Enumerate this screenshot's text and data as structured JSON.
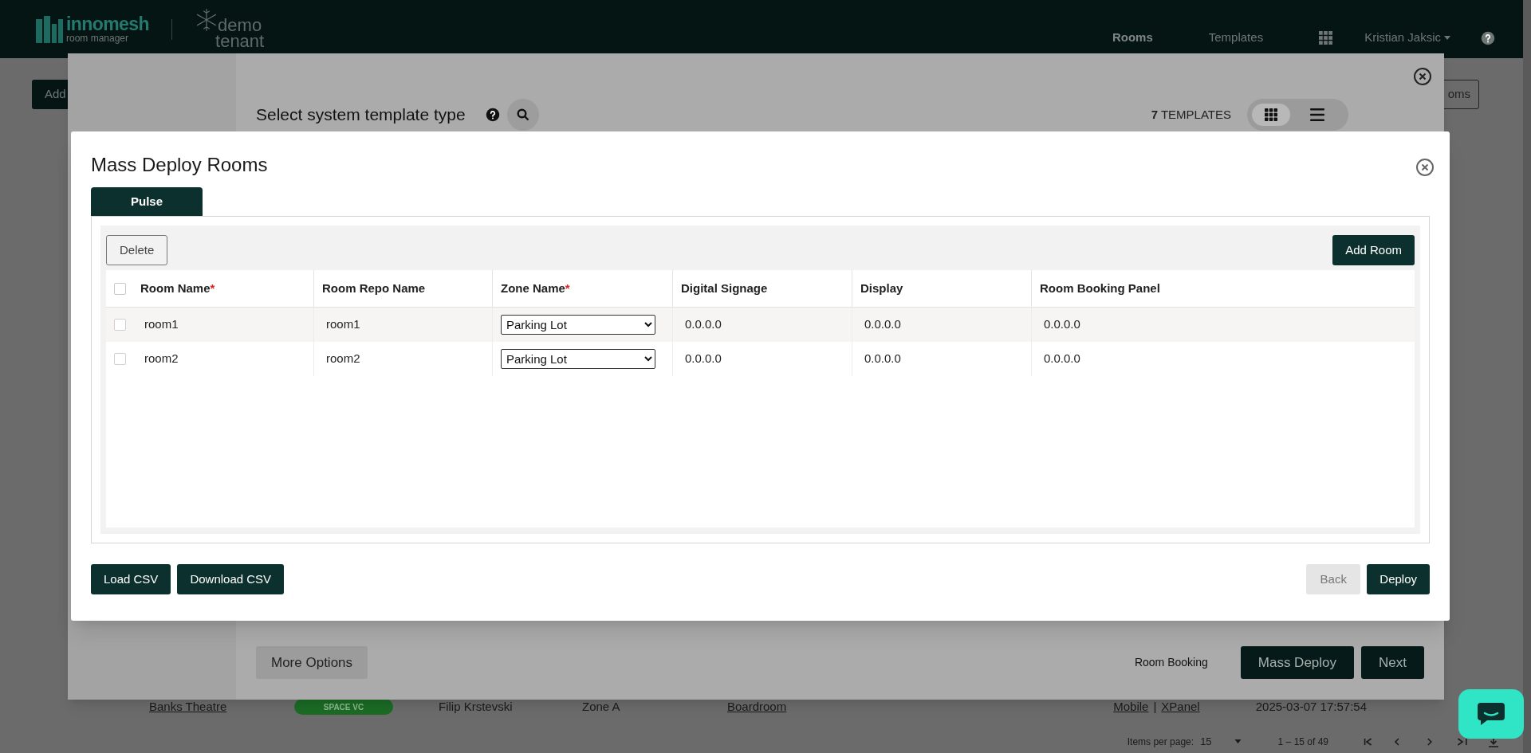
{
  "header": {
    "logo_name": "innomesh",
    "logo_tagline": "room manager",
    "tenant": [
      "demo",
      "tenant"
    ],
    "nav": [
      {
        "label": "Rooms",
        "selected": true
      },
      {
        "label": "Templates",
        "selected": false
      }
    ],
    "user": "Kristian Jaksic"
  },
  "page": {
    "add_button": "Add",
    "right_button": "oms",
    "row": {
      "name": "Banks Theatre",
      "tag": "SPACE VC",
      "owner": "Filip Krstevski",
      "zone": "Zone A",
      "type": "Boardroom",
      "links": [
        "Mobile",
        "XPanel"
      ],
      "separator": "|",
      "date": "2025-03-07 17:57:54"
    },
    "pagination": {
      "label": "Items per page:",
      "per_page": "15",
      "range": "1 – 15 of 49"
    }
  },
  "template_dialog": {
    "title": "Select system template type",
    "count": "**7** TEMPLATES",
    "view_modes": [
      {
        "kind": "grid",
        "selected": true
      },
      {
        "kind": "list",
        "selected": false
      }
    ],
    "more_options": "More Options",
    "room_booking": "Room Booking",
    "buttons": [
      "Mass Deploy",
      "Next"
    ]
  },
  "mass_deploy": {
    "title": "Mass Deploy Rooms",
    "tabs": [
      {
        "label": "Pulse",
        "selected": true
      }
    ],
    "delete": "Delete",
    "add_room": "Add Room",
    "select_all_checked": false,
    "columns": [
      {
        "label": "Room Name",
        "required_mark": "*"
      },
      {
        "label": "Room Repo Name"
      },
      {
        "label": "Zone Name",
        "required_mark": "*"
      },
      {
        "label": "Digital Signage"
      },
      {
        "label": "Display"
      },
      {
        "label": "Room Booking Panel"
      }
    ],
    "rows": [
      {
        "checked": false,
        "room_name": "room1",
        "repo_name": "room1",
        "zone": "Parking Lot",
        "digital_signage": "0.0.0.0",
        "display": "0.0.0.0",
        "booking_panel": "0.0.0.0"
      },
      {
        "checked": false,
        "room_name": "room2",
        "repo_name": "room2",
        "zone": "Parking Lot",
        "digital_signage": "0.0.0.0",
        "display": "0.0.0.0",
        "booking_panel": "0.0.0.0"
      }
    ],
    "csv_buttons": [
      "Load CSV",
      "Download CSV"
    ],
    "back": {
      "label": "Back",
      "disabled": true
    },
    "deploy": "Deploy"
  }
}
